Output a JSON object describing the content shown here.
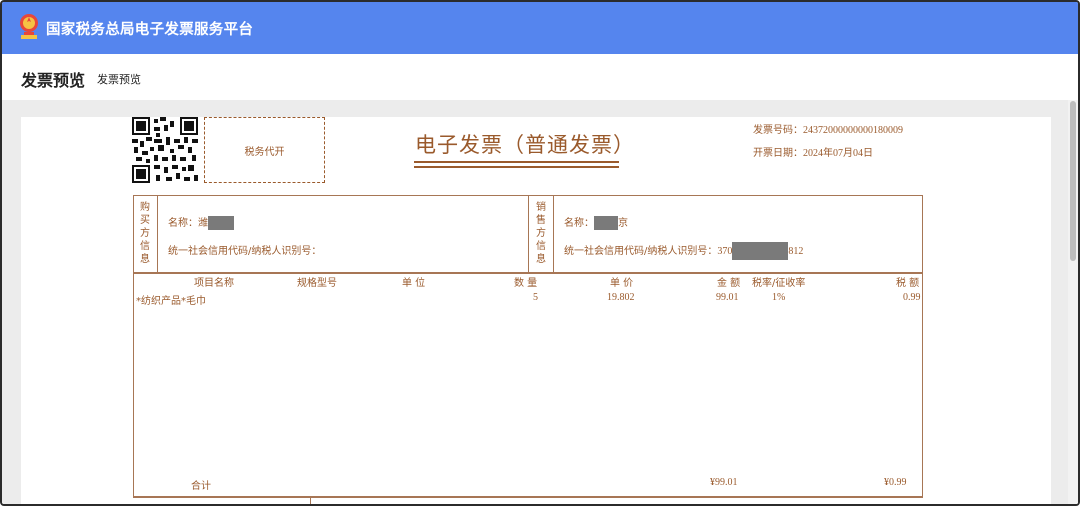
{
  "app": {
    "title": "国家税务总局电子发票服务平台"
  },
  "page": {
    "title": "发票预览",
    "breadcrumb": "发票预览"
  },
  "invoice": {
    "stamp_label": "税务代开",
    "title": "电子发票（普通发票）",
    "number_label": "发票号码：",
    "number": "24372000000000180009",
    "date_label": "开票日期：",
    "date": "2024年07月04日",
    "buyer": {
      "side_label": [
        "购",
        "买",
        "方",
        "信",
        "息"
      ],
      "name_label": "名称：",
      "name_visible": "潍",
      "tax_id_label": "统一社会信用代码/纳税人识别号："
    },
    "seller": {
      "side_label": [
        "销",
        "售",
        "方",
        "信",
        "息"
      ],
      "name_label": "名称：",
      "name_visible_suffix": "京",
      "tax_id_label": "统一社会信用代码/纳税人识别号：",
      "tax_id_prefix": "370",
      "tax_id_suffix": "812"
    },
    "columns": {
      "item_name": "项目名称",
      "spec": "规格型号",
      "unit": "单 位",
      "qty": "数 量",
      "price": "单 价",
      "amount": "金 额",
      "rate": "税率/征收率",
      "tax": "税 额"
    },
    "items": [
      {
        "name": "*纺织产品*毛巾",
        "spec": "",
        "unit": "",
        "qty": "5",
        "price": "19.802",
        "amount": "99.01",
        "rate": "1%",
        "tax": "0.99"
      }
    ],
    "total_label": "合计",
    "total_amount": "¥99.01",
    "total_tax": "¥0.99"
  },
  "colors": {
    "header": "#5585ee",
    "invoice_text": "#9a5a2c",
    "invoice_border": "#a77655"
  }
}
